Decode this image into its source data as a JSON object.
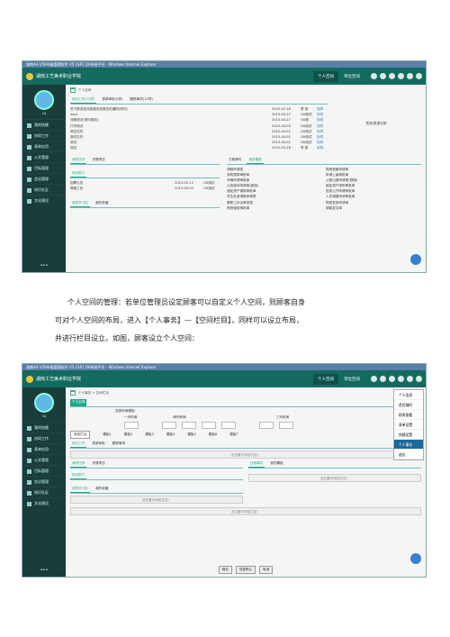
{
  "screenshot1": {
    "ie_title": "湖南AA V59中级管理软件 V5.1SP1 OA系统平台 - Windows Internet Explorer",
    "app_name": "湖南工艺美术职业学院",
    "nav": [
      "个人空间",
      "单位空间"
    ],
    "user": "1A",
    "sidebar": [
      "我的快捷",
      "协同工作",
      "表单应用",
      "公文管理",
      "目标管理",
      "会议管理",
      "知识社区",
      "文化建设"
    ],
    "breadcrumb": "个人空间",
    "tabs": [
      "待办工作(15项)",
      "表单审批(0项)",
      "跟踪事项(15项)"
    ],
    "more": "更多",
    "rows": [
      {
        "t": "关于报送迎评促建自查报告的通知(测试)",
        "d": "2015-07-16",
        "u": "李 锐",
        "m": "协同"
      },
      {
        "t": "xxxx",
        "d": "2015-05-07",
        "u": "OA测试",
        "m": "协同"
      },
      {
        "t": "流程测试(请示报告)",
        "d": "2015-04-27",
        "u": "OA测",
        "m": "协同"
      },
      {
        "t": "打印测试",
        "d": "2015-04-03",
        "u": "OA测试",
        "m": "协同"
      },
      {
        "t": "测试文件",
        "d": "2015-04-02",
        "u": "OA测试",
        "m": "协同"
      },
      {
        "t": "测试文件",
        "d": "2015-04-02",
        "u": "OA测试",
        "m": "协同"
      },
      {
        "t": "测试",
        "d": "2015-04-02",
        "u": "OA测试",
        "m": "协同"
      },
      {
        "t": "测试",
        "d": "2015-03-26",
        "u": "李 锐",
        "m": "协同"
      }
    ],
    "side_note": "签到/签退记录",
    "mid_tabs_left": [
      "我的任务",
      "关联项目"
    ],
    "dept_label": "测试部门",
    "dept_rows": [
      {
        "t": "招聘公告",
        "d": "2015-05-12",
        "u": "OA测试"
      },
      {
        "t": "简报工作",
        "d": "2015-05-02",
        "u": "OA测试"
      }
    ],
    "mid_tabs_right": [
      "日程事件",
      "我的模板"
    ],
    "templates_left": [
      "请假申请表",
      "采购预算审批单",
      "车辆申请审批单",
      "公务接待申请单(差旅)",
      "固定资产调拨审批单",
      "学生处室请假申请表",
      "教职工外出审批表",
      "物资使用审批单"
    ],
    "templates_right": [
      "物资报废申请单",
      "申请上级审批单",
      "公差出差申请表(预借)",
      "固定资产申购审批单",
      "信息公开申请审批单",
      "人员调整申请审批单",
      "物资发放申请单",
      "请款发文单"
    ],
    "bottom_tabs": [
      "我的学习区",
      "我的收藏"
    ]
  },
  "paragraph": [
    "个人空间的管理：若单位管理员设定顾客可以自定义个人空间，则顾客自身",
    "可对个人空间的布局，进入【个人事务】—【空间栏目】，同样可以设立布局，",
    "并进行栏目设立。如图，顾客设立个人空间："
  ],
  "screenshot2": {
    "breadcrumb": "个人事务 > 空间栏目",
    "section": "个人空间",
    "layout_label": "选择布局模板:",
    "col_labels": [
      "一列布局",
      "两列布局",
      "三列布局"
    ],
    "opts": [
      "模板1",
      "模板2",
      "模板3",
      "模板4",
      "模板5",
      "模板6",
      "模板7"
    ],
    "add_btn": "添加栏目",
    "tabs1": [
      "待办工作",
      "表单审批",
      "跟踪事项"
    ],
    "placeholder": "此位置可添加栏目！",
    "tabs2": [
      "我的任务",
      "关联项目"
    ],
    "dept": "测试部门",
    "tabs3": [
      "日程事件",
      "我的模板"
    ],
    "tabs4": [
      "我的学习区",
      "我的收藏"
    ],
    "menu": [
      "个人信息",
      "首页随时",
      "职责查看",
      "表单设置",
      "快捷设置",
      "个人事务",
      "退出"
    ],
    "selected_menu": "个人事务",
    "buttons": [
      "确定",
      "恢复默认",
      "取消"
    ]
  }
}
